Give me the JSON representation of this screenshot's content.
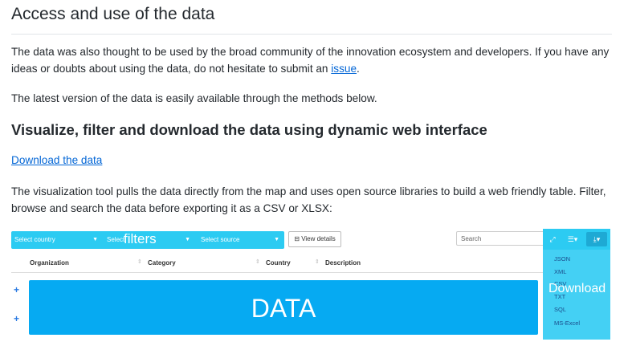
{
  "section": {
    "title": "Access and use of the data",
    "para1_text": "The data was also thought to be used by the broad community of the innovation ecosystem and developers. If you have any ideas or doubts about using the data, do not hesitate to submit an ",
    "para1_link": "issue",
    "para1_end": ".",
    "para2": "The latest version of the data is easily available through the methods below."
  },
  "subsection": {
    "title": "Visualize, filter and download the data using dynamic web interface",
    "download_link": "Download the data",
    "para": "The visualization tool pulls the data directly from the map and uses open source libraries to build a web friendly table. Filter, browse and search the data before exporting it as a CSV or XLSX:"
  },
  "embed": {
    "filters": {
      "country_placeholder": "Select country",
      "category_placeholder": "Select",
      "source_placeholder": "Select source",
      "overlay_label": "filters"
    },
    "view_details": "View details",
    "search_placeholder": "Search",
    "columns": [
      "Organization",
      "Category",
      "Country",
      "Description"
    ],
    "data_label": "DATA",
    "download_label": "Download",
    "download_options": [
      "JSON",
      "XML",
      "CSV",
      "TXT",
      "SQL",
      "MS-Excel"
    ],
    "expand_symbol": "+"
  },
  "colors": {
    "filter_bar": "#2ccbf2",
    "data_block": "#06aaf2",
    "download_panel": "#44d0f4",
    "link": "#0366d6"
  }
}
